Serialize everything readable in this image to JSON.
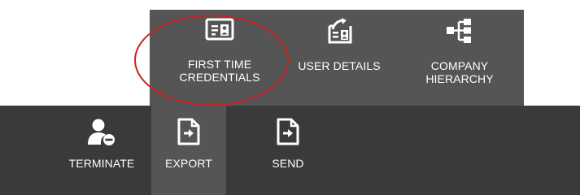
{
  "toolbar_top": {
    "items": [
      {
        "label_line1": "FIRST TIME",
        "label_line2": "CREDENTIALS",
        "icon": "id-card-icon"
      },
      {
        "label": "USER DETAILS",
        "icon": "user-details-icon"
      },
      {
        "label_line1": "COMPANY",
        "label_line2": "HIERARCHY",
        "icon": "hierarchy-icon"
      }
    ]
  },
  "toolbar_bottom": {
    "items": [
      {
        "label": "TERMINATE",
        "icon": "user-remove-icon"
      },
      {
        "label": "EXPORT",
        "icon": "export-document-icon",
        "selected": true
      },
      {
        "label": "SEND",
        "icon": "send-document-icon"
      }
    ]
  },
  "colors": {
    "top_bar_bg": "#555555",
    "bottom_bar_bg": "#3a3a3a",
    "selected_bg": "#555555",
    "annotation": "#cc2222",
    "text": "#ffffff"
  }
}
